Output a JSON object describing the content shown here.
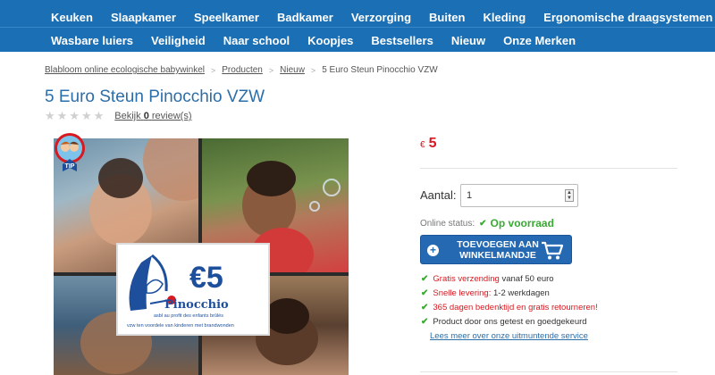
{
  "nav": {
    "row1": [
      "Keuken",
      "Slaapkamer",
      "Speelkamer",
      "Badkamer",
      "Verzorging",
      "Buiten",
      "Kleding",
      "Ergonomische draagsystemen"
    ],
    "row2": [
      "Wasbare luiers",
      "Veiligheid",
      "Naar school",
      "Koopjes",
      "Bestsellers",
      "Nieuw",
      "Onze Merken"
    ]
  },
  "breadcrumb": {
    "items": [
      "Blabloom online ecologische babywinkel",
      "Producten",
      "Nieuw"
    ],
    "current": "5 Euro Steun Pinocchio VZW"
  },
  "product": {
    "title": "5 Euro Steun Pinocchio VZW",
    "rating_stars": 0,
    "review_prefix": "Bekijk",
    "review_count": "0",
    "review_suffix": "review(s)"
  },
  "image": {
    "tip_badge": "TIP",
    "voucher_amount": "€5",
    "voucher_brand": "Pinocchio",
    "voucher_line1": "asbl au profit des enfants brûlés",
    "voucher_line2": "vzw ten voordele van kinderen met brandwonden"
  },
  "price": {
    "currency": "€",
    "amount": "5"
  },
  "quantity": {
    "label": "Aantal:",
    "value": "1"
  },
  "stock": {
    "label": "Online status:",
    "value": "Op voorraad"
  },
  "add_to_cart": {
    "label": "TOEVOEGEN AAN WINKELMANDJE"
  },
  "benefits": [
    {
      "highlight": "Gratis verzending",
      "rest": " vanaf 50 euro"
    },
    {
      "highlight": "Snelle levering:",
      "rest": " 1-2 werkdagen"
    },
    {
      "highlight": "365 dagen bedenktijd en gratis retourneren!",
      "rest": ""
    },
    {
      "highlight": "",
      "rest": "Product door ons getest en goedgekeurd"
    }
  ],
  "service_link": "Lees meer over onze uitmuntende service",
  "colors": {
    "nav": "#1b6fb5",
    "title": "#2b6ea8",
    "price": "#d71920",
    "stock": "#3aaa35",
    "button": "#2569b2"
  }
}
